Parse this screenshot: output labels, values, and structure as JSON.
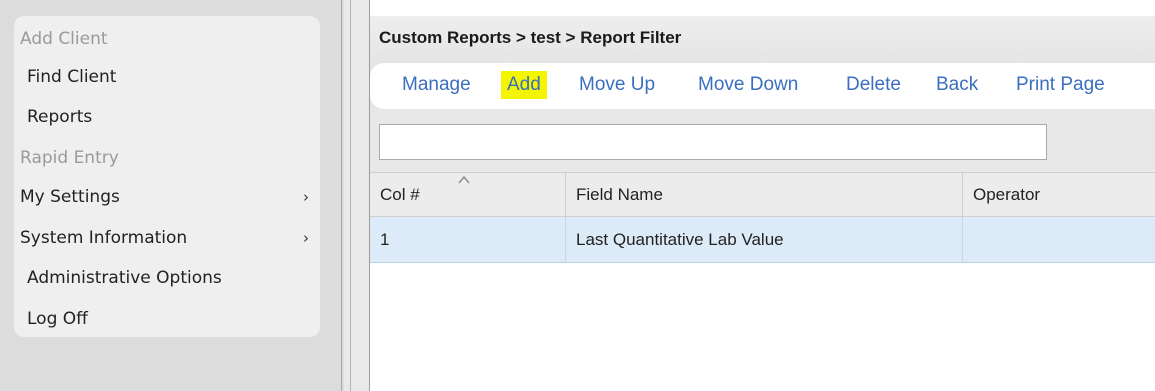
{
  "sidebar": {
    "items": [
      {
        "label": "Add Client",
        "disabled": true,
        "submenu": false
      },
      {
        "label": "Find Client",
        "disabled": false,
        "submenu": false
      },
      {
        "label": "Reports",
        "disabled": false,
        "submenu": false
      },
      {
        "label": "Rapid Entry",
        "disabled": true,
        "submenu": false
      },
      {
        "label": "My Settings",
        "disabled": false,
        "submenu": true
      },
      {
        "label": "System Information",
        "disabled": false,
        "submenu": true
      },
      {
        "label": "Administrative Options",
        "disabled": false,
        "submenu": false
      },
      {
        "label": "Log Off",
        "disabled": false,
        "submenu": false
      }
    ],
    "chevron_glyph": "›"
  },
  "header": {
    "breadcrumb": "Custom Reports > test > Report Filter"
  },
  "toolbar": {
    "manage_label": "Manage",
    "add_label": "Add",
    "move_up_label": "Move Up",
    "move_down_label": "Move Down",
    "delete_label": "Delete",
    "back_label": "Back",
    "print_label": "Print Page",
    "highlighted_item": "Add",
    "highlight_color": "#f4f500",
    "link_color": "#3a6fbf"
  },
  "filter": {
    "value": "",
    "placeholder": ""
  },
  "grid": {
    "columns": [
      "Col #",
      "Field Name",
      "Operator"
    ],
    "sorted_column": "Col #",
    "sort_direction": "ascending",
    "rows": [
      {
        "col_num": "1",
        "field_name": "Last Quantitative Lab Value",
        "operator": ""
      }
    ],
    "selected_row_color": "#dcebf7"
  }
}
